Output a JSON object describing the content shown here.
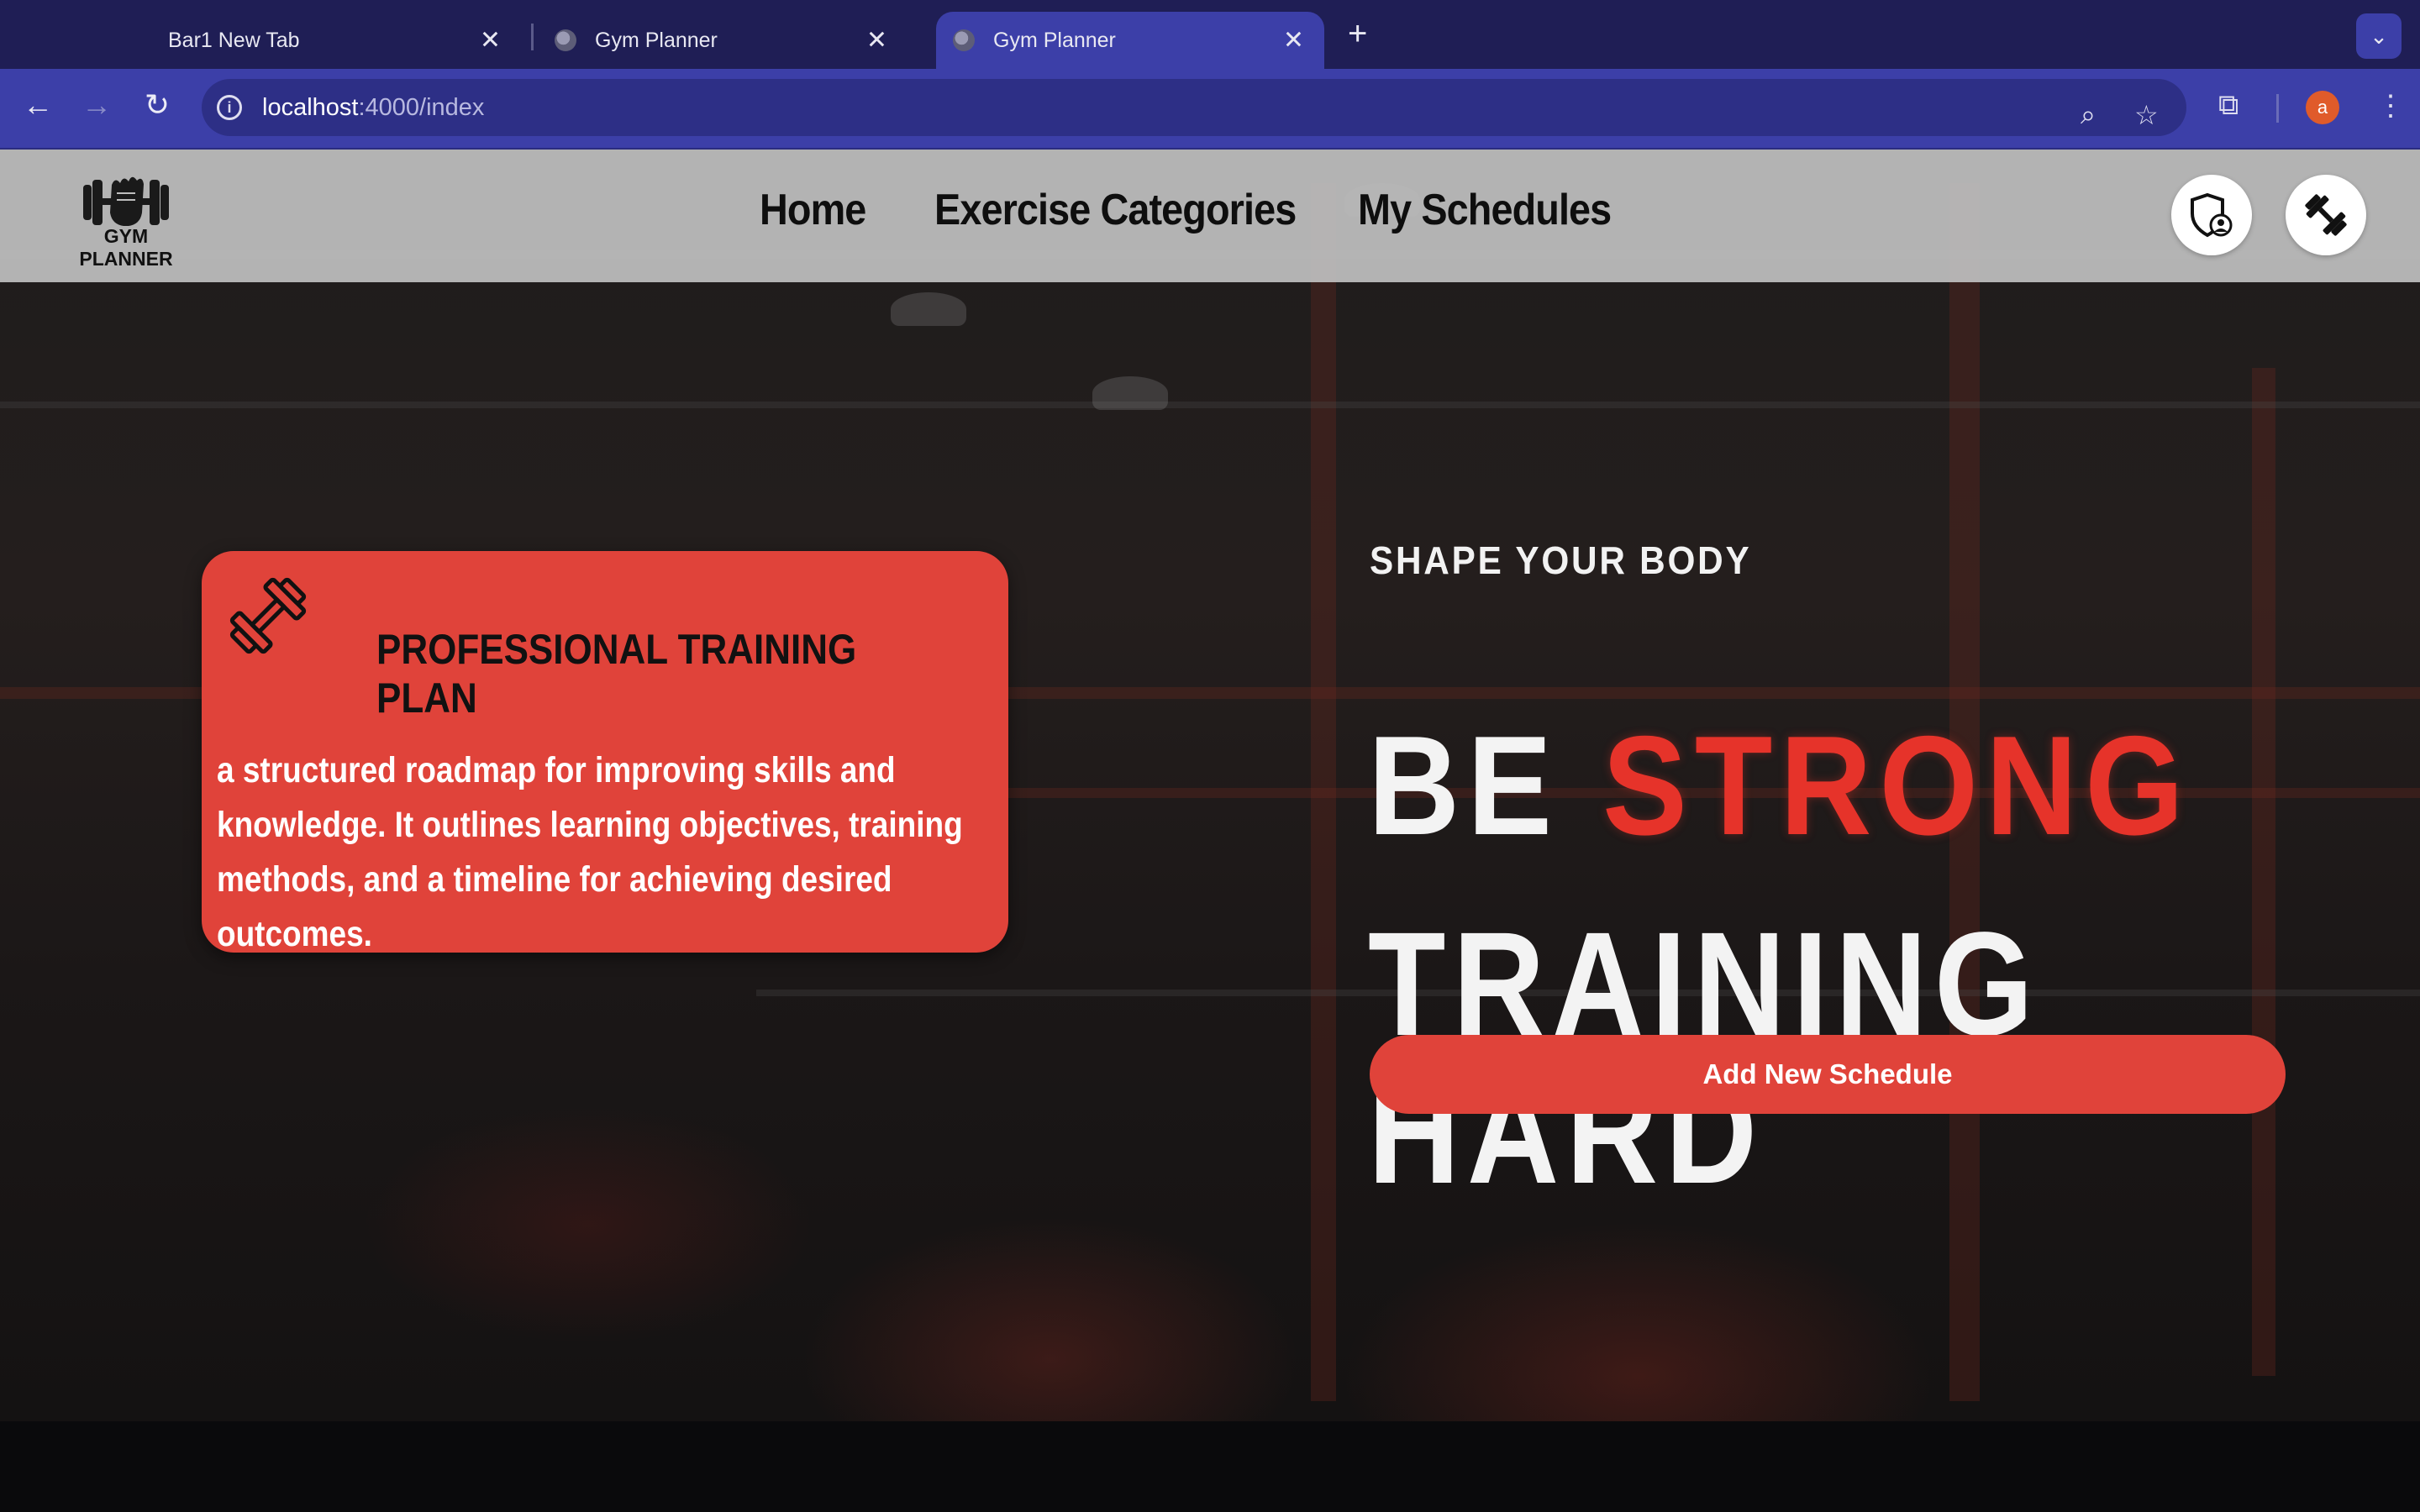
{
  "browser": {
    "tabs": [
      {
        "title": "Bar1 New Tab",
        "active": false
      },
      {
        "title": "Gym Planner",
        "active": false
      },
      {
        "title": "Gym Planner",
        "active": true
      }
    ],
    "url": {
      "host": "localhost",
      "path": ":4000/index"
    },
    "profile_initial": "a",
    "colors": {
      "tabstrip": "#1f1e55",
      "toolbar": "#3c3fa8",
      "omnibox": "#2d2f86"
    }
  },
  "site": {
    "logo_text": "GYM PLANNER",
    "nav": {
      "home": "Home",
      "categories": "Exercise Categories",
      "schedules": "My Schedules"
    },
    "icons": [
      "admin-shield-icon",
      "dumbbell-icon"
    ]
  },
  "card": {
    "title": "PROFESSIONAL TRAINING PLAN",
    "body": "a structured roadmap for improving skills and knowledge. It outlines learning objectives, training methods, and a timeline for achieving desired outcomes."
  },
  "hero": {
    "kicker": "SHAPE YOUR BODY",
    "line1_a": "BE",
    "line1_b": "STRONG",
    "line2": "TRAINING HARD",
    "cta": "Add New Schedule"
  },
  "colors": {
    "accent": "#e0433a",
    "headline_red": "#e6332a",
    "nav_bg": "#bebebe"
  }
}
